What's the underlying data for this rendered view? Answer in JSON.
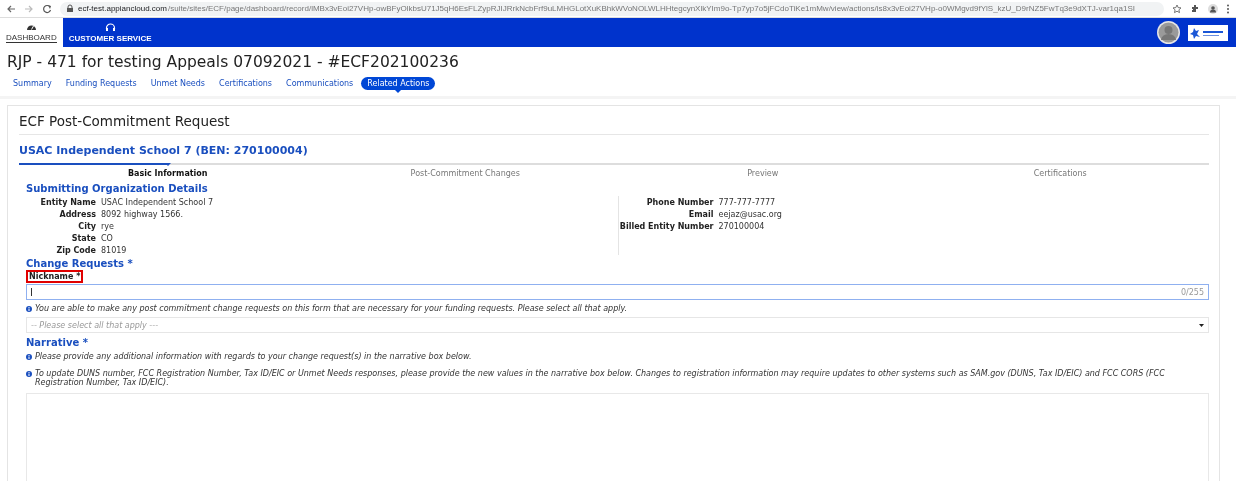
{
  "browser": {
    "url_host": "ecf-test.appiancloud.com",
    "url_path": "/suite/sites/ECF/page/dashboard/record/lMBx3vEoi27VHp-owBFyOlkbsU71J5qH6EsFLZypRJIJRrkNcbFrf9uLMHGLotXuKBhkWVoNOLWLHHtegcynXlkYIm9o-Tp7yp7o5jFCdoTiKe1mMw/view/actions/is8x3vEoi27VHp-o0WMgvd9fYlS_kzU_D9rNZ5FwTq3e9dXTJ-var1qa1SI"
  },
  "nav": [
    {
      "label": "DASHBOARD",
      "kind": "dashboard",
      "selected": true
    },
    {
      "label": "CUSTOMER SERVICE",
      "kind": "support",
      "selected": false
    }
  ],
  "page_title": "RJP - 471 for testing Appeals 07092021 - #ECF202100236",
  "tabs": [
    {
      "label": "Summary",
      "selected": false
    },
    {
      "label": "Funding Requests",
      "selected": false
    },
    {
      "label": "Unmet Needs",
      "selected": false
    },
    {
      "label": "Certifications",
      "selected": false
    },
    {
      "label": "Communications",
      "selected": false
    },
    {
      "label": "Related Actions",
      "selected": true
    }
  ],
  "form": {
    "title": "ECF Post-Commitment Request",
    "entity_heading": "USAC Independent School 7 (BEN: 270100004)",
    "steps": [
      {
        "label": "Basic Information",
        "selected": true
      },
      {
        "label": "Post-Commitment Changes",
        "selected": false
      },
      {
        "label": "Preview",
        "selected": false
      },
      {
        "label": "Certifications",
        "selected": false
      }
    ],
    "org_heading": "Submitting Organization Details",
    "left_fields": [
      {
        "label": "Entity Name",
        "value": "USAC Independent School 7"
      },
      {
        "label": "Address",
        "value": "8092 highway 1566."
      },
      {
        "label": "City",
        "value": "rye"
      },
      {
        "label": "State",
        "value": "CO"
      },
      {
        "label": "Zip Code",
        "value": "81019"
      }
    ],
    "right_fields": [
      {
        "label": "Phone Number",
        "value": "777-777-7777"
      },
      {
        "label": "Email",
        "value": "eejaz@usac.org"
      },
      {
        "label": "Billed Entity Number",
        "value": "270100004"
      }
    ],
    "change_heading": "Change Requests *",
    "nickname": {
      "label": "Nickname *",
      "highlighted": true,
      "counter": "0/255"
    },
    "change_info": "You are able to make any post commitment change requests on this form that are necessary for your funding requests. Please select all that apply.",
    "select": {
      "placeholder": "-- Please select all that apply ---"
    },
    "narrative_heading": "Narrative *",
    "narrative_notes": [
      "Please provide any additional information with regards to your change request(s) in the narrative box below.",
      "To update DUNS number, FCC Registration Number, Tax ID/EIC or Unmet Needs responses, please provide the new values in the narrative box below. Changes to registration information may require updates to other systems such as SAM.gov (DUNS, Tax ID/EIC) and FCC CORS (FCC Registration Number, Tax ID/EIC)."
    ]
  }
}
